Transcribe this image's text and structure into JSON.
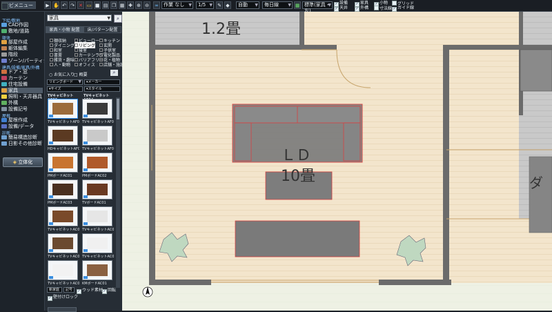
{
  "toolbar": {
    "top_left_button": "ナビメニュー",
    "display_mode": "作業 なし",
    "scale": "1/5",
    "view_select": "自動",
    "height_select": "毎日線",
    "standard_select": "標準(家具・左)",
    "checks": [
      {
        "label": "設備",
        "checked": true
      },
      {
        "label": "家具",
        "checked": true
      },
      {
        "label": "小物",
        "checked": true
      },
      {
        "label": "グリッド",
        "checked": false
      },
      {
        "label": "天井",
        "checked": true
      },
      {
        "label": "外構",
        "checked": true
      },
      {
        "label": "寸法線",
        "checked": false
      },
      {
        "label": "ガイド線",
        "checked": true
      }
    ]
  },
  "leftnav": {
    "sections": [
      {
        "header": "下絵/敷地",
        "items": [
          {
            "label": "CAD作図",
            "icon": "cad-icon"
          },
          {
            "label": "敷地/道路",
            "icon": "site-icon"
          }
        ]
      },
      {
        "header": "躯体",
        "items": [
          {
            "label": "部屋作成",
            "icon": "room-icon"
          },
          {
            "label": "躯体編集",
            "icon": "structure-icon"
          },
          {
            "label": "階段",
            "icon": "stairs-icon"
          },
          {
            "label": "ゾーン/パーティション",
            "icon": "zone-icon"
          }
        ]
      },
      {
        "header": "建具/設備/家具/外構",
        "items": [
          {
            "label": "ドア・窓",
            "icon": "door-icon"
          },
          {
            "label": "カーテン",
            "icon": "curtain-icon"
          },
          {
            "label": "住宅設備",
            "icon": "equipment-icon"
          },
          {
            "label": "家具",
            "icon": "furniture-icon",
            "selected": true
          },
          {
            "label": "照明・天井器具",
            "icon": "light-icon"
          },
          {
            "label": "外構",
            "icon": "exterior-icon"
          },
          {
            "label": "設備記号",
            "icon": "symbol-icon"
          }
        ]
      },
      {
        "header": "屋根",
        "items": [
          {
            "label": "屋根作成",
            "icon": "roof-icon"
          },
          {
            "label": "設備/データ",
            "icon": "data-icon"
          }
        ]
      },
      {
        "header": "診断",
        "items": [
          {
            "label": "簡易構造診断",
            "icon": "diagnosis-icon"
          },
          {
            "label": "日影その他診断",
            "icon": "shadow-icon"
          }
        ]
      }
    ],
    "render_button": "立体化"
  },
  "panel": {
    "search_value": "家具",
    "tabs": [
      "家具・小物 配置",
      "床/パターン配置"
    ],
    "categories": [
      {
        "label": "棚収納"
      },
      {
        "label": "ビューロー"
      },
      {
        "label": "キッチン"
      },
      {
        "label": "ダイニング"
      },
      {
        "label": "リビング",
        "selected": true
      },
      {
        "label": "玄関"
      },
      {
        "label": "和室"
      },
      {
        "label": "寝室"
      },
      {
        "label": "子供室"
      },
      {
        "label": "書斎"
      },
      {
        "label": "カーテンラグ"
      },
      {
        "label": "電化製品"
      },
      {
        "label": "雑貨・趣味"
      },
      {
        "label": "バリアフリー"
      },
      {
        "label": "花・植物"
      },
      {
        "label": "人・動物"
      },
      {
        "label": "オフィス"
      },
      {
        "label": "店舗・施設"
      }
    ],
    "favorites": "お気に入り",
    "overview": "概要",
    "filter1": "リビングボード",
    "filter2": "メーカー",
    "filter3": "サイズ",
    "filter4": "スタイル",
    "group_label": "TVキャビネットAF02",
    "group_label2": "TVキャビネットAF04",
    "items": [
      {
        "caption": "TVキャビネットAF03"
      },
      {
        "caption": "TVキャビネットAF04"
      },
      {
        "caption": "HDキャビネットAF02"
      },
      {
        "caption": "TVキャビネットAF01"
      },
      {
        "caption": "PMボードAC01"
      },
      {
        "caption": "PMボードAC02"
      },
      {
        "caption": "PMボードAC03"
      },
      {
        "caption": "TVボードAC01"
      },
      {
        "caption": "TVキャビネットAC01"
      },
      {
        "caption": "TVキャビネットAC02"
      },
      {
        "caption": "TVキャビネットAC03"
      },
      {
        "caption": "TVキャビネットAC04"
      },
      {
        "caption": "TVキャビネットAC01"
      },
      {
        "caption": "KMボードAC01"
      }
    ],
    "bottom_select": "新家庭",
    "bottom_select2": "記号",
    "chk_keep": "ウッド素材",
    "chk_keep2": "回転",
    "chk_follow": "壁付けロック"
  },
  "canvas": {
    "room_top": "1.2畳",
    "room_main_name": "ＬＤ",
    "room_main_size": "10畳",
    "room_right": "ダ",
    "colors": {
      "floor": "#f3e6cf",
      "wall": "#707070",
      "selection": "#d64040"
    }
  }
}
